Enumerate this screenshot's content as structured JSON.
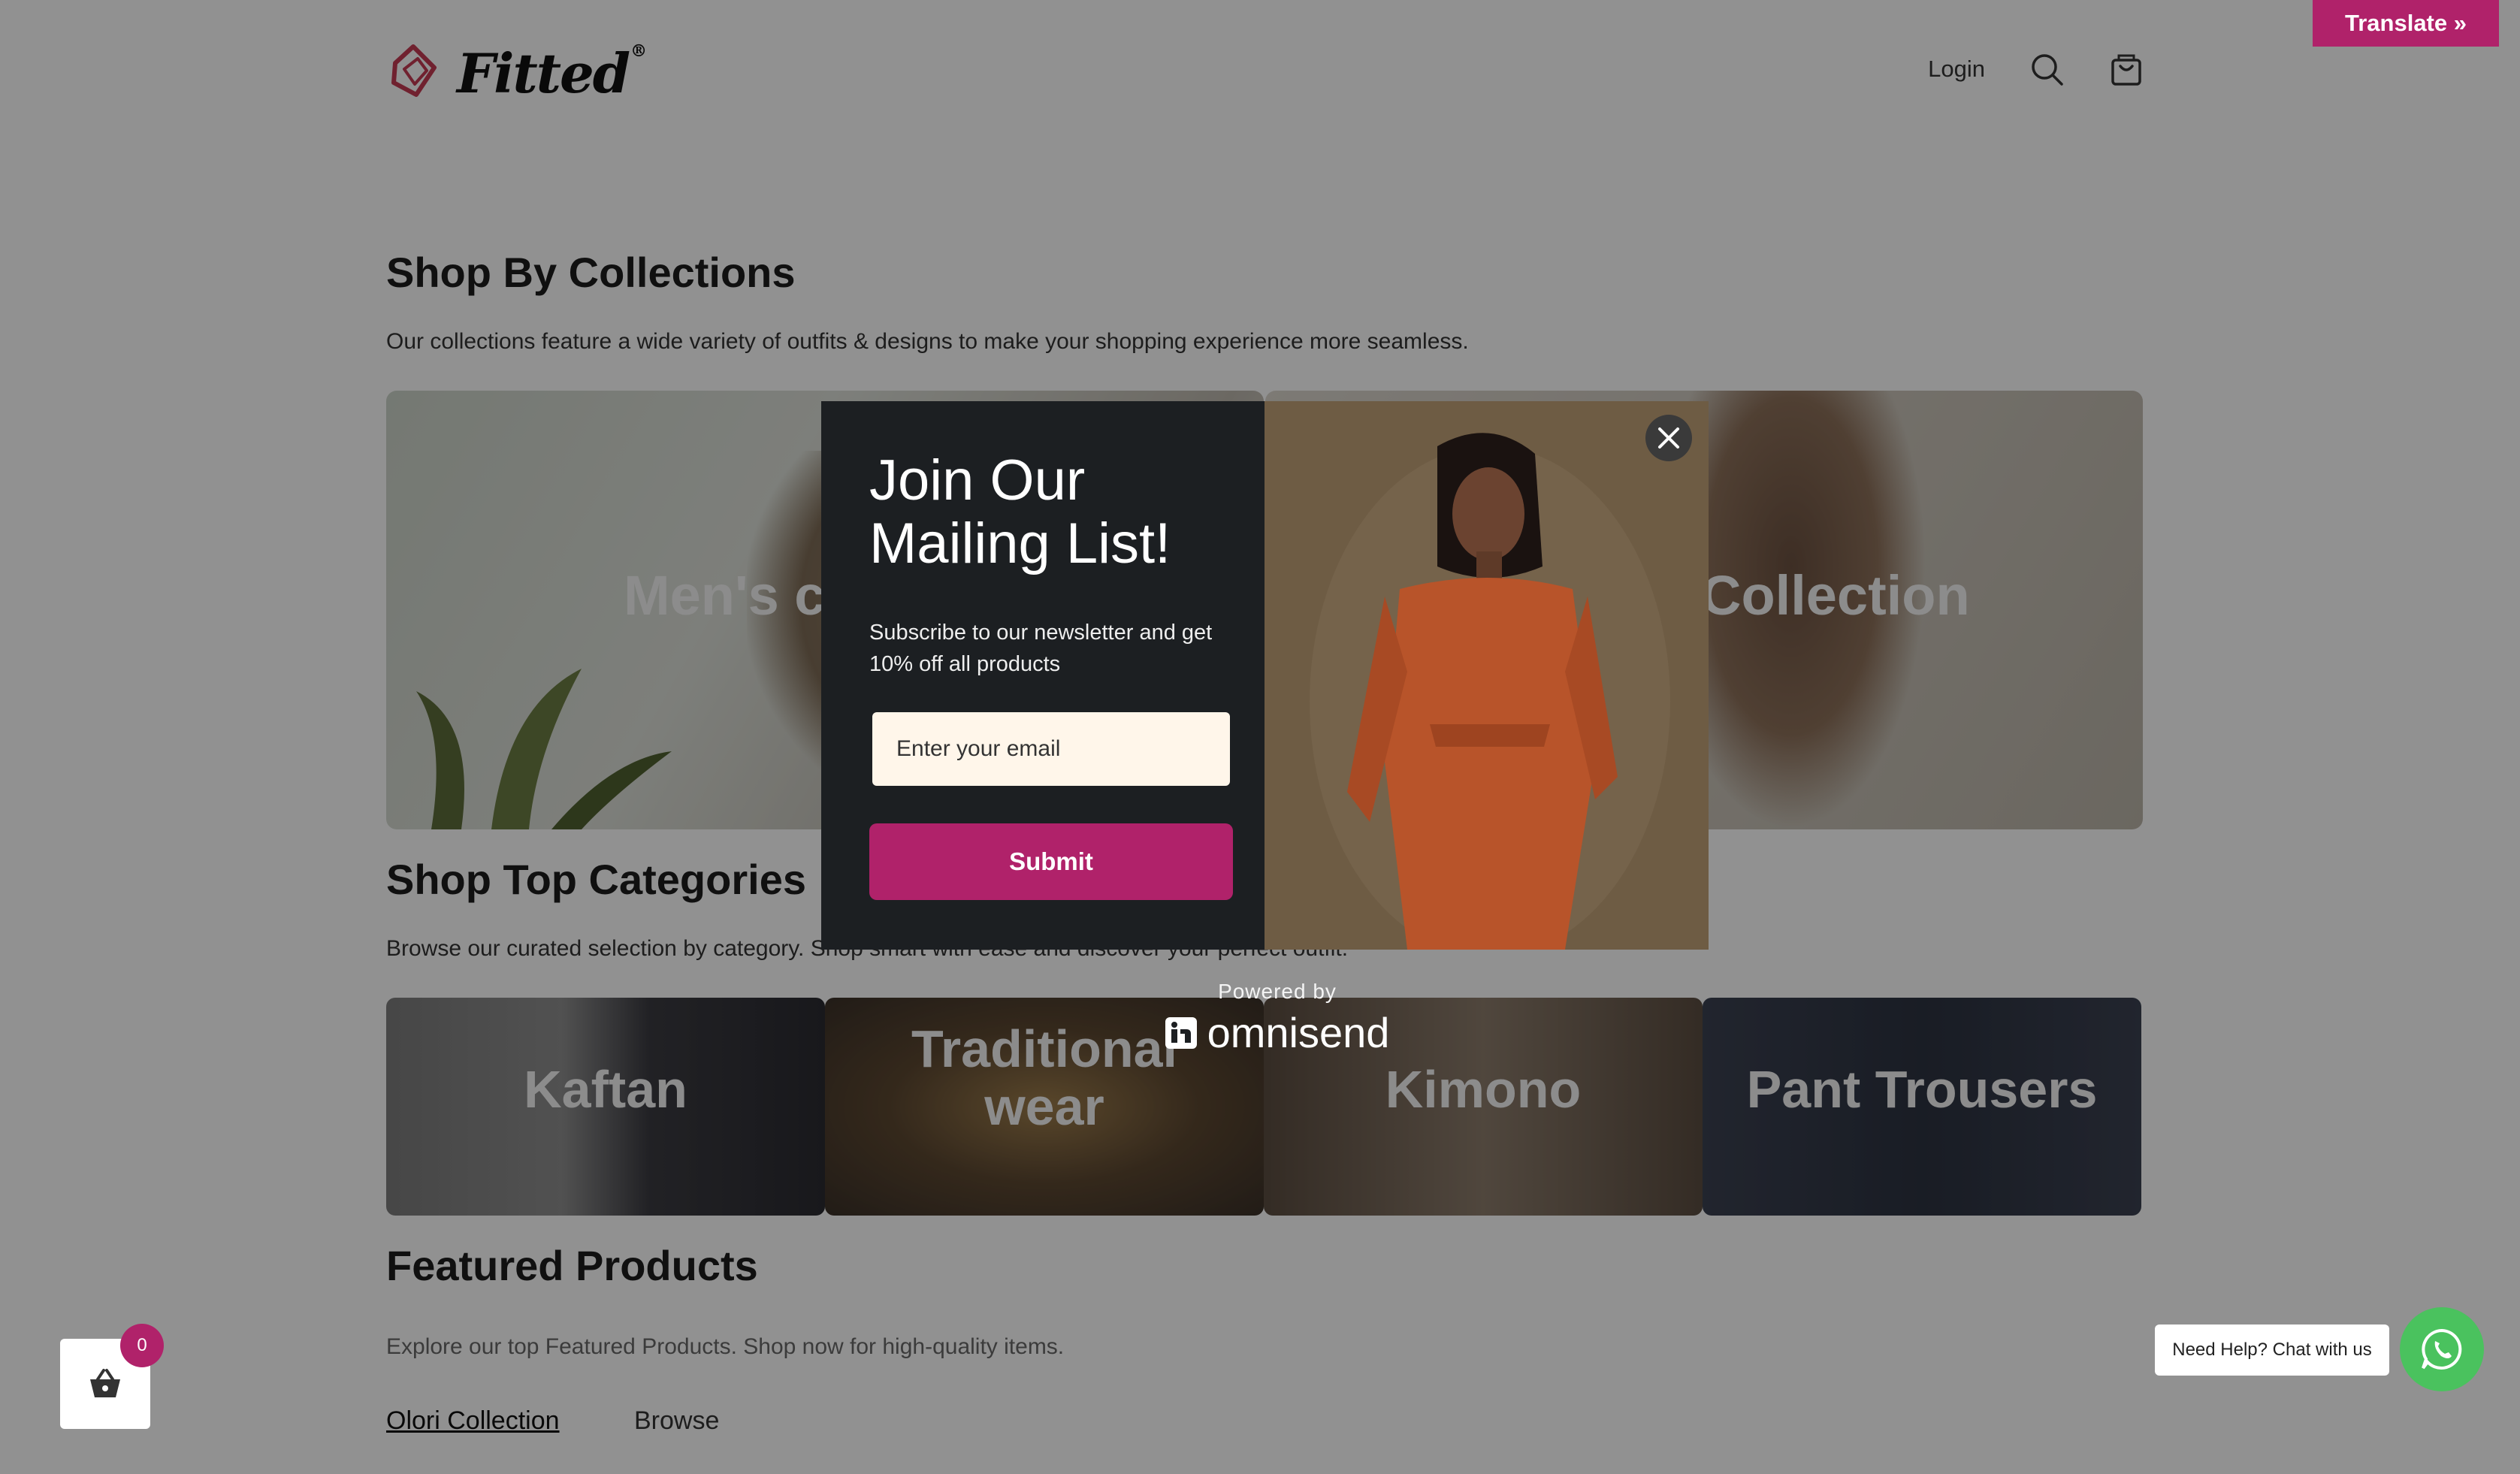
{
  "translate": {
    "label": "Translate »"
  },
  "header": {
    "logo_text": "Fitted",
    "logo_reg": "®",
    "login_label": "Login",
    "icons": [
      "search-icon",
      "cart-icon"
    ]
  },
  "collections": {
    "title": "Shop By Collections",
    "description": "Our collections feature a wide variety of outfits & designs to make your shopping experience more seamless.",
    "cards": [
      {
        "label": "Men's co"
      },
      {
        "label": "Collection"
      }
    ]
  },
  "categories": {
    "title": "Shop Top Categories",
    "description": "Browse our curated selection by category. Shop smart with ease and discover your perfect outfit.",
    "cards": [
      {
        "label": "Kaftan"
      },
      {
        "label": "Traditional wear"
      },
      {
        "label": "Kimono"
      },
      {
        "label": "Pant Trousers"
      }
    ]
  },
  "featured": {
    "title": "Featured Products",
    "description": "Explore our top Featured Products. Shop now for high-quality items.",
    "tabs": [
      "Olori Collection",
      "Browse"
    ]
  },
  "modal": {
    "title": "Join Our Mailing List!",
    "subtitle": "Subscribe to our newsletter and get 10% off all products",
    "email_placeholder": "Enter your email",
    "submit_label": "Submit"
  },
  "powered": {
    "by": "Powered by",
    "brand": "omnisend"
  },
  "cart_float": {
    "count": "0"
  },
  "chat": {
    "label": "Need Help? Chat with us"
  },
  "colors": {
    "accent": "#b0226a",
    "whatsapp": "#4ac25e",
    "modal_bg": "#1c1f22",
    "input_bg": "#fff6ea"
  }
}
